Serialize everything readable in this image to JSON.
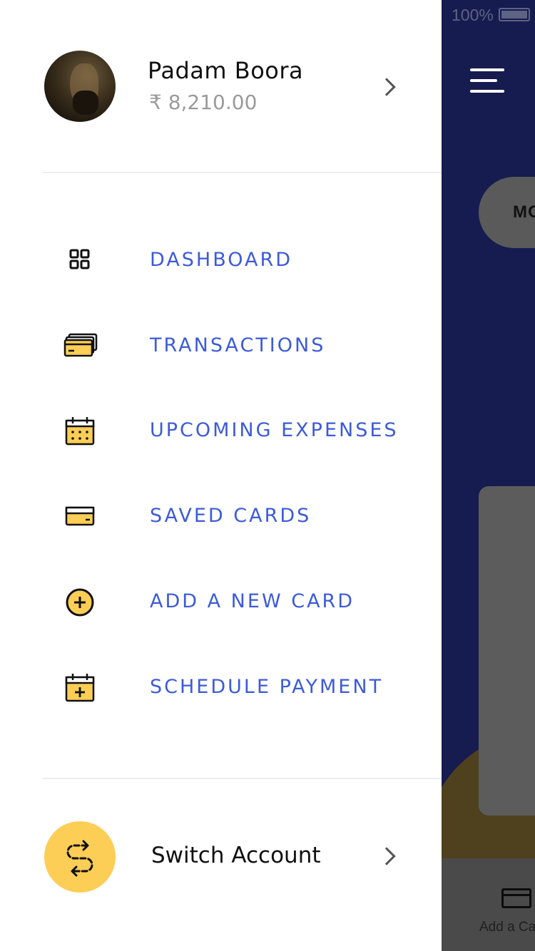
{
  "status_bar": {
    "battery_text": "100%"
  },
  "background_app": {
    "pill_label": "MO",
    "bottom_bar_label": "Add a Ca"
  },
  "profile": {
    "name": "Padam Boora",
    "balance": "₹ 8,210.00"
  },
  "menu": {
    "items": [
      {
        "label": "DASHBOARD",
        "icon": "dashboard-grid-icon"
      },
      {
        "label": "TRANSACTIONS",
        "icon": "cards-stack-icon"
      },
      {
        "label": "UPCOMING EXPENSES",
        "icon": "calendar-icon"
      },
      {
        "label": "SAVED CARDS",
        "icon": "credit-card-icon"
      },
      {
        "label": "ADD A NEW CARD",
        "icon": "plus-circle-icon"
      },
      {
        "label": "SCHEDULE PAYMENT",
        "icon": "calendar-plus-icon"
      }
    ]
  },
  "switch_account": {
    "label": "Switch Account",
    "icon": "switch-arrows-icon"
  },
  "colors": {
    "accent_blue": "#3d5bd8",
    "yellow": "#fcce55",
    "app_navy": "#161c4f"
  }
}
